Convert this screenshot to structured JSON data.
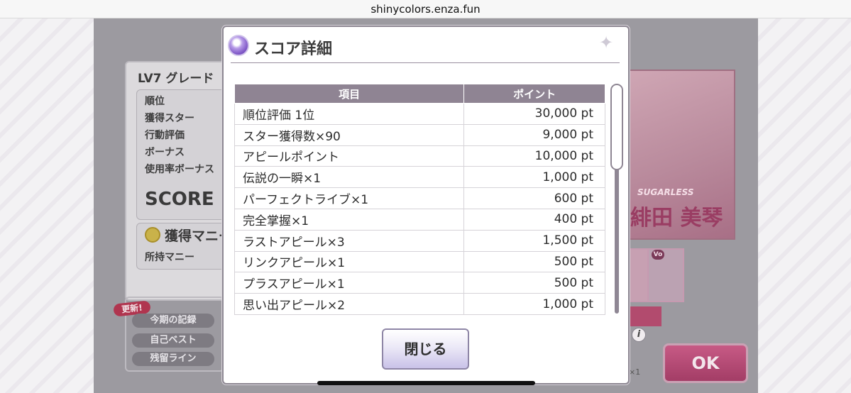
{
  "browser": {
    "url": "shinycolors.enza.fun"
  },
  "background": {
    "panel_title": "LV7 グレード",
    "rows": [
      "順位",
      "獲得スター",
      "行動評価",
      "ボーナス",
      "使用率ボーナス"
    ],
    "score_label": "SCORE",
    "money_title": "獲得マニー",
    "money_sub": "所持マニー",
    "new_badge": "更新!",
    "buttons": [
      "今期の記録",
      "自己ベスト",
      "残留ライン"
    ],
    "card_tag": "SUGARLESS",
    "card_name": "緋田 美琴",
    "vo_badge": "Vo",
    "info_icon_text": "i",
    "ok_label": "OK",
    "multiplier": "×1"
  },
  "modal": {
    "title": "スコア詳細",
    "table": {
      "headers": {
        "item": "項目",
        "points": "ポイント"
      },
      "rows": [
        {
          "item": "順位評価 1位",
          "points": "30,000 pt"
        },
        {
          "item": "スター獲得数×90",
          "points": "9,000 pt"
        },
        {
          "item": "アピールポイント",
          "points": "10,000 pt"
        },
        {
          "item": "伝説の一瞬×1",
          "points": "1,000 pt"
        },
        {
          "item": "パーフェクトライブ×1",
          "points": "600 pt"
        },
        {
          "item": "完全掌握×1",
          "points": "400 pt"
        },
        {
          "item": "ラストアピール×3",
          "points": "1,500 pt"
        },
        {
          "item": "リンクアピール×1",
          "points": "500 pt"
        },
        {
          "item": "プラスアピール×1",
          "points": "500 pt"
        },
        {
          "item": "思い出アピール×2",
          "points": "1,000 pt"
        }
      ]
    },
    "close_label": "閉じる"
  },
  "colors": {
    "header": "#8f8493",
    "accent": "#a33d66",
    "overlay": "#9c9aa0"
  }
}
